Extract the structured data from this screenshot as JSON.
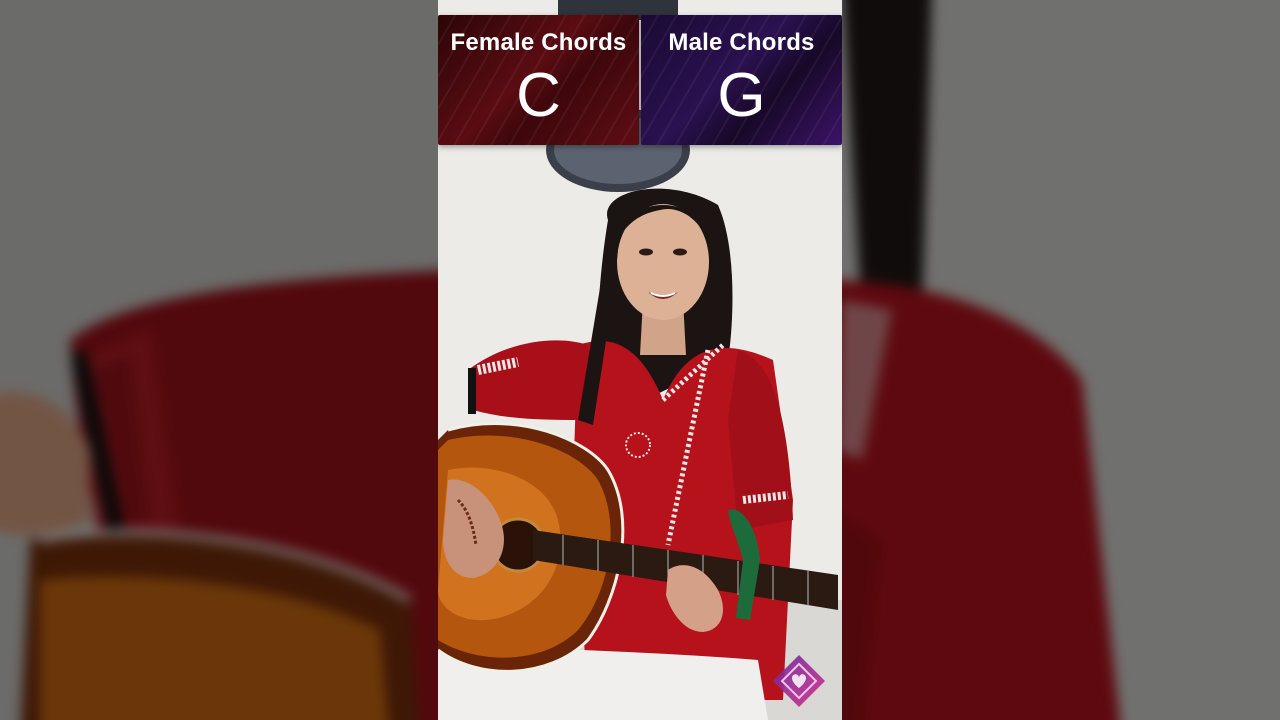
{
  "overlay": {
    "female": {
      "title": "Female Chords",
      "chord": "C"
    },
    "male": {
      "title": "Male Chords",
      "chord": "G"
    }
  },
  "scene": {
    "subject": "woman in red kurta playing acoustic guitar with capo",
    "wall_color": "#ecebe8",
    "kurta_color": "#b5121b",
    "guitar_body_color": "#8a3a10",
    "capo_color": "#1d6b3a"
  },
  "icons": {
    "channel_logo": "heart-diamond-logo-icon"
  },
  "colors": {
    "female_panel": "#5a0c12",
    "male_panel": "#2a1150",
    "logo_accent": "#c0279a"
  }
}
